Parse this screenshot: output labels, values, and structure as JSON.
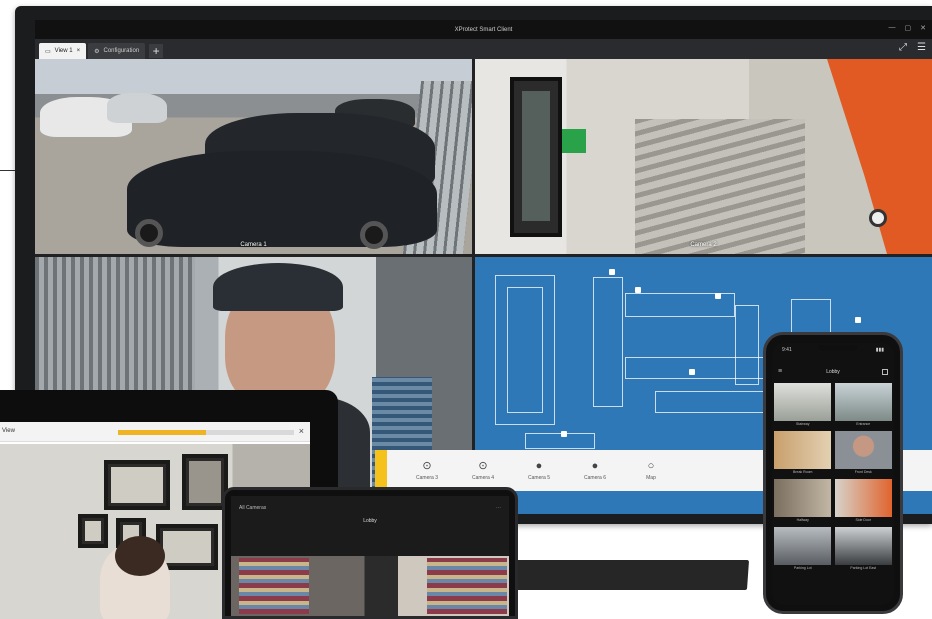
{
  "window": {
    "title": "XProtect Smart Client",
    "controls": [
      "—",
      "▢",
      "✕"
    ]
  },
  "tabs": [
    {
      "label": "View 1",
      "icon": "monitor-icon",
      "active": true
    },
    {
      "label": "Configuration",
      "icon": "gear-icon",
      "active": false
    }
  ],
  "tab_add_label": "+",
  "top_right": {
    "expand": "⤢",
    "menu": "☰"
  },
  "cameras": [
    {
      "label": "Camera 1"
    },
    {
      "label": "Camera 2"
    }
  ],
  "strip": {
    "items": [
      {
        "label": "Camera 3",
        "icon": "camera-icon"
      },
      {
        "label": "Camera 4",
        "icon": "camera-icon"
      },
      {
        "label": "Camera 5",
        "icon": "camera-icon"
      },
      {
        "label": "Camera 6",
        "icon": "camera-icon"
      },
      {
        "label": "Map",
        "icon": "map-icon"
      }
    ]
  },
  "laptop": {
    "title": "View",
    "progress": 0.5,
    "close": "×"
  },
  "tablet": {
    "left": "All Cameras",
    "title": "Lobby",
    "right": "⋯",
    "menu": "≡"
  },
  "phone": {
    "time": "9:41",
    "signal": "▮▮▮",
    "title": "Lobby",
    "thumbnails": [
      {
        "label": "Stairway"
      },
      {
        "label": "Entrance"
      },
      {
        "label": "Break Room"
      },
      {
        "label": "Front Desk"
      },
      {
        "label": "Hallway"
      },
      {
        "label": "Side Door"
      },
      {
        "label": "Parking Lot"
      },
      {
        "label": "Parking Lot East"
      }
    ]
  },
  "colors": {
    "accent": "#f5c21b",
    "map_blue": "#2f78b8",
    "bezel": "#1b1c1e"
  }
}
